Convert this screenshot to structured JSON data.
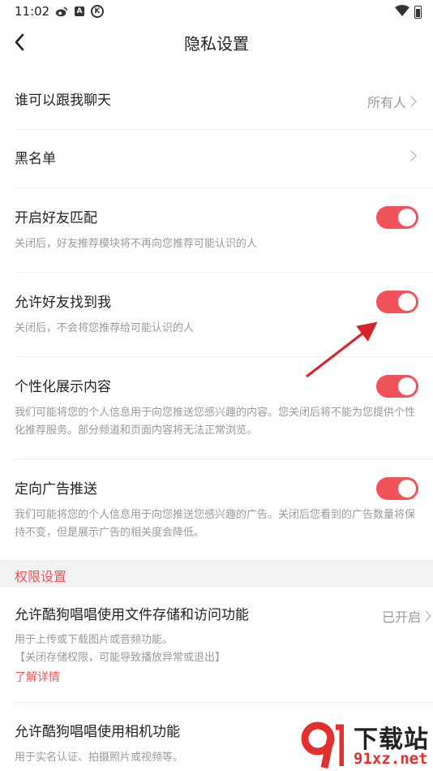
{
  "status_bar": {
    "time": "11:02",
    "icons_left": [
      "weibo-icon",
      "a-badge-icon",
      "k-circle-icon"
    ],
    "badge_a": "A",
    "badge_k": "K",
    "icons_right": [
      "wifi-icon",
      "battery-icon"
    ]
  },
  "nav": {
    "title": "隐私设置",
    "back_icon": "chevron-left-icon"
  },
  "rows": [
    {
      "title": "谁可以跟我聊天",
      "value": "所有人"
    },
    {
      "title": "黑名单",
      "value": ""
    },
    {
      "title": "开启好友匹配",
      "desc": "关闭后，好友推荐模块将不再向您推荐可能认识的人",
      "toggle_on": true
    },
    {
      "title": "允许好友找到我",
      "desc": "关闭后，不会将您推荐给可能认识的人",
      "toggle_on": true
    },
    {
      "title": "个性化展示内容",
      "desc": "我们可能将您的个人信息用于向您推送您感兴趣的内容。您关闭后将不能为您提供个性化推荐服务。部分频道和页面内容将无法正常浏览。",
      "toggle_on": true
    },
    {
      "title": "定向广告推送",
      "desc": "我们可能将您的个人信息用于向您推送您感兴趣的广告。关闭后您看到的广告数量将保持不变，但是展示广告的相关度会降低。",
      "toggle_on": true
    }
  ],
  "permissions_section": {
    "header": "权限设置",
    "items": [
      {
        "title": "允许酷狗唱唱使用文件存储和访问功能",
        "value": "已开启",
        "desc": "用于上传或下载图片或音频功能。",
        "warning": "【关闭存储权限，可能导致播放异常或退出】",
        "link": "了解详情"
      },
      {
        "title": "允许酷狗唱唱使用相机功能",
        "desc": "用于实名认证、拍摄照片或视频等。"
      }
    ]
  },
  "watermark": {
    "main": "下载站",
    "url": "91xz.net"
  },
  "colors": {
    "accent": "#f25259",
    "secondary_text": "#9a9a9a",
    "section_bg": "#f2f2f2",
    "arrow": "#d9222a"
  }
}
